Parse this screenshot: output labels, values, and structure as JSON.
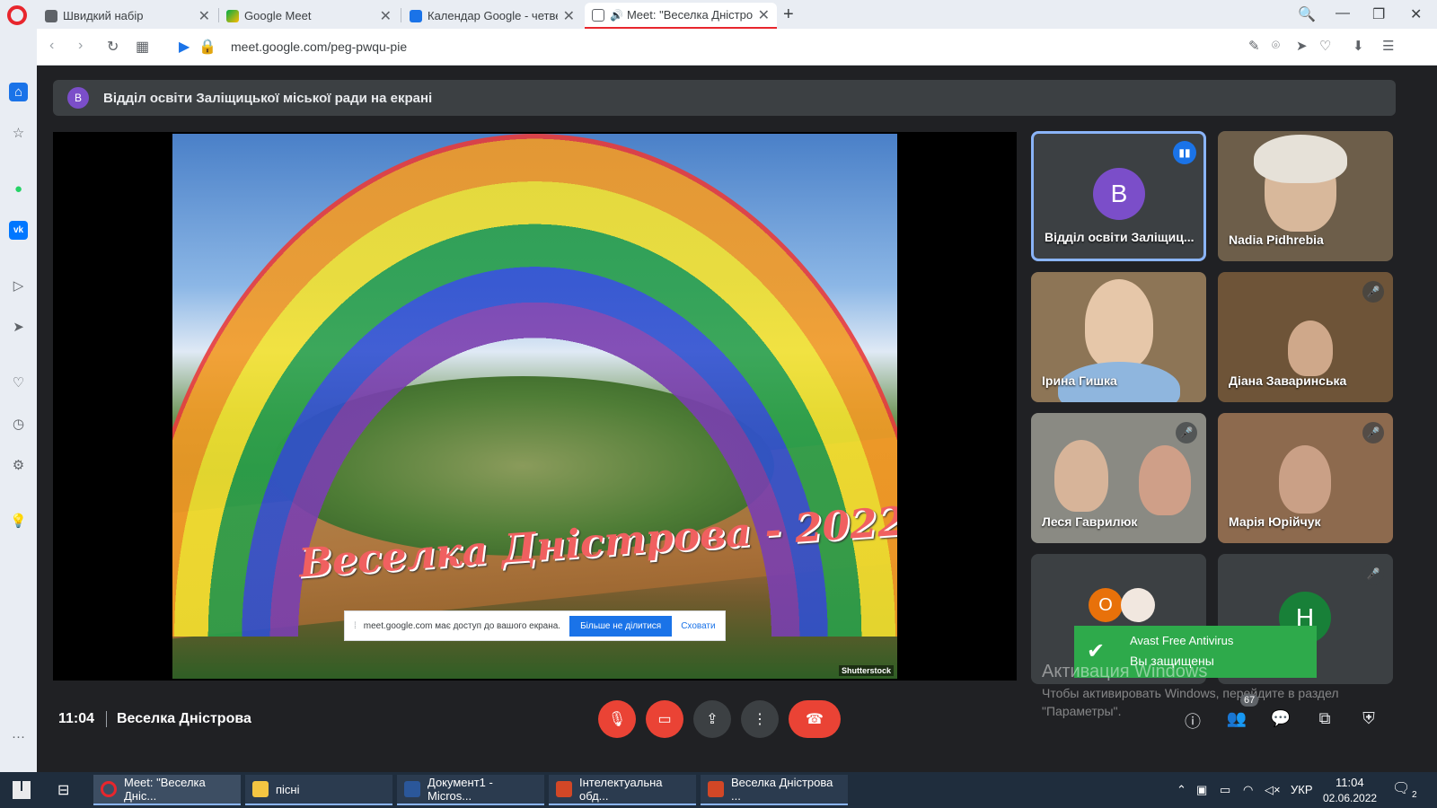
{
  "browser": {
    "tabs": [
      {
        "label": "Швидкий набір",
        "icon": "speed-dial-icon"
      },
      {
        "label": "Google Meet",
        "icon": "meet-icon"
      },
      {
        "label": "Календар Google - четвер",
        "icon": "calendar-icon"
      },
      {
        "label": "Meet: \"Веселка Дністро",
        "icon": "meet-icon"
      }
    ],
    "url": "meet.google.com/peg-pwqu-pie"
  },
  "meet": {
    "presenting_banner": {
      "avatar_letter": "В",
      "text": "Відділ освіти Заліщицької міської ради на екрані"
    },
    "slide": {
      "title": "Веселка Дністрова - 2022",
      "credit": "Shutterstock"
    },
    "share_notice": {
      "text": "meet.google.com має доступ до вашого екрана.",
      "stop_label": "Більше не ділитися",
      "hide_label": "Сховати"
    },
    "participants": [
      {
        "name": "Відділ освіти Заліщиц...",
        "letter": "В"
      },
      {
        "name": "Nadia Pidhrebia"
      },
      {
        "name": "Ірина Гишка"
      },
      {
        "name": "Діана Заваринська"
      },
      {
        "name": "Леся Гаврилюк"
      },
      {
        "name": "Марія Юрійчук"
      },
      {
        "letter": "О"
      },
      {
        "letter": "Н"
      }
    ],
    "meeting_time": "11:04",
    "meeting_name": "Веселка Дністрова",
    "participants_count": "67",
    "colors": {
      "accent": "#1a73e8",
      "end_call": "#ea4335",
      "speaking_border": "#8ab4f8"
    }
  },
  "avast": {
    "title": "Avast Free Antivirus",
    "message": "Вы защищены"
  },
  "windows_activation": {
    "title": "Активация Windows",
    "line1": "Чтобы активировать Windows, перейдите в раздел",
    "line2": "\"Параметры\"."
  },
  "taskbar": {
    "apps": [
      {
        "label": "Meet: \"Веселка Дніс..."
      },
      {
        "label": "пісні"
      },
      {
        "label": "Документ1 - Micros..."
      },
      {
        "label": "Інтелектуальна обд..."
      },
      {
        "label": "Веселка Дністрова ..."
      }
    ],
    "lang": "УКР",
    "time": "11:04",
    "date": "02.06.2022",
    "notifications": "2"
  }
}
